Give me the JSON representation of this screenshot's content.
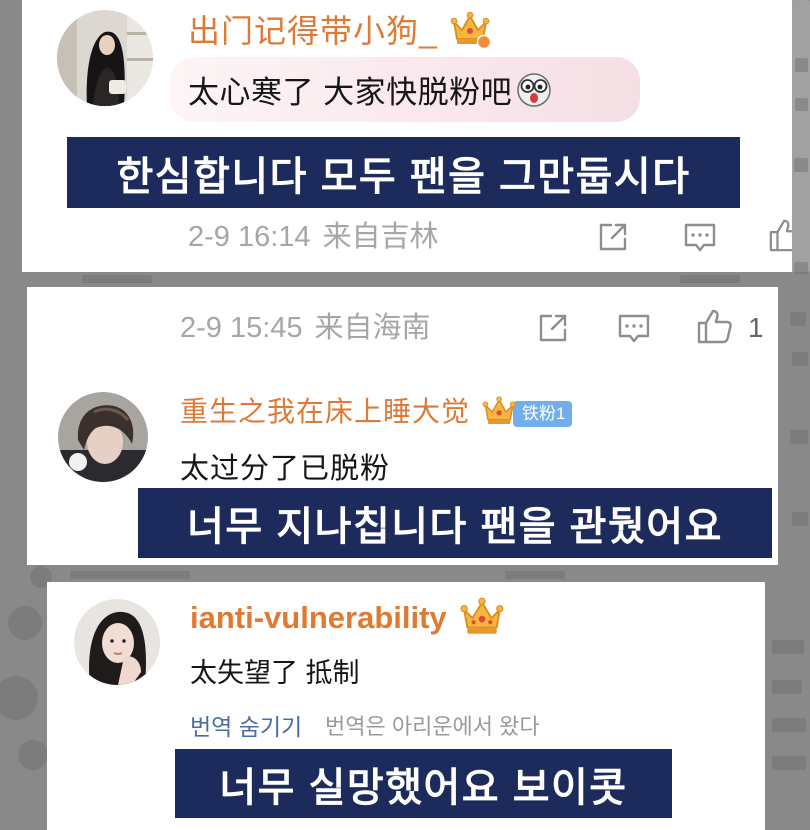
{
  "cards": [
    {
      "username": "出门记得带小狗_",
      "badge_icon": "crown-icon",
      "text": "太心寒了 大家快脱粉吧",
      "emoji": "shocked-face-emoji",
      "subtitle": "한심합니다 모두 팬을 그만둡시다",
      "footer": {
        "timestamp": "2-9 16:14",
        "location": "来自吉林"
      },
      "actions": [
        "share-icon",
        "comment-icon",
        "like-icon"
      ]
    },
    {
      "footer": {
        "timestamp": "2-9 15:45",
        "location": "来自海南",
        "like_count": "1"
      },
      "actions": [
        "share-icon",
        "comment-icon",
        "like-icon"
      ],
      "username": "重生之我在床上睡大觉",
      "badge_icon": "crown-icon",
      "fan_badge": "铁粉1",
      "text": "太过分了已脱粉",
      "subtitle": "너무 지나칩니다 팬을 관뒀어요"
    },
    {
      "username": "ianti-vulnerability",
      "badge_icon": "crown-icon",
      "text": "太失望了 抵制",
      "translation_toggle": "번역 숨기기",
      "translation_source": "번역은 아리운에서 왔다",
      "subtitle": "너무 실망했어요 보이콧"
    }
  ],
  "colors": {
    "background": "#898989",
    "card": "#ffffff",
    "username": "#de7a38",
    "subtitle_background": "#1d2a5c",
    "subtitle_text": "#ffffff",
    "meta_text": "#a6a6a6",
    "translation_toggle": "#4a6ca8",
    "fan_badge": "#72aeec",
    "action_icon": "#8e8e8e"
  }
}
